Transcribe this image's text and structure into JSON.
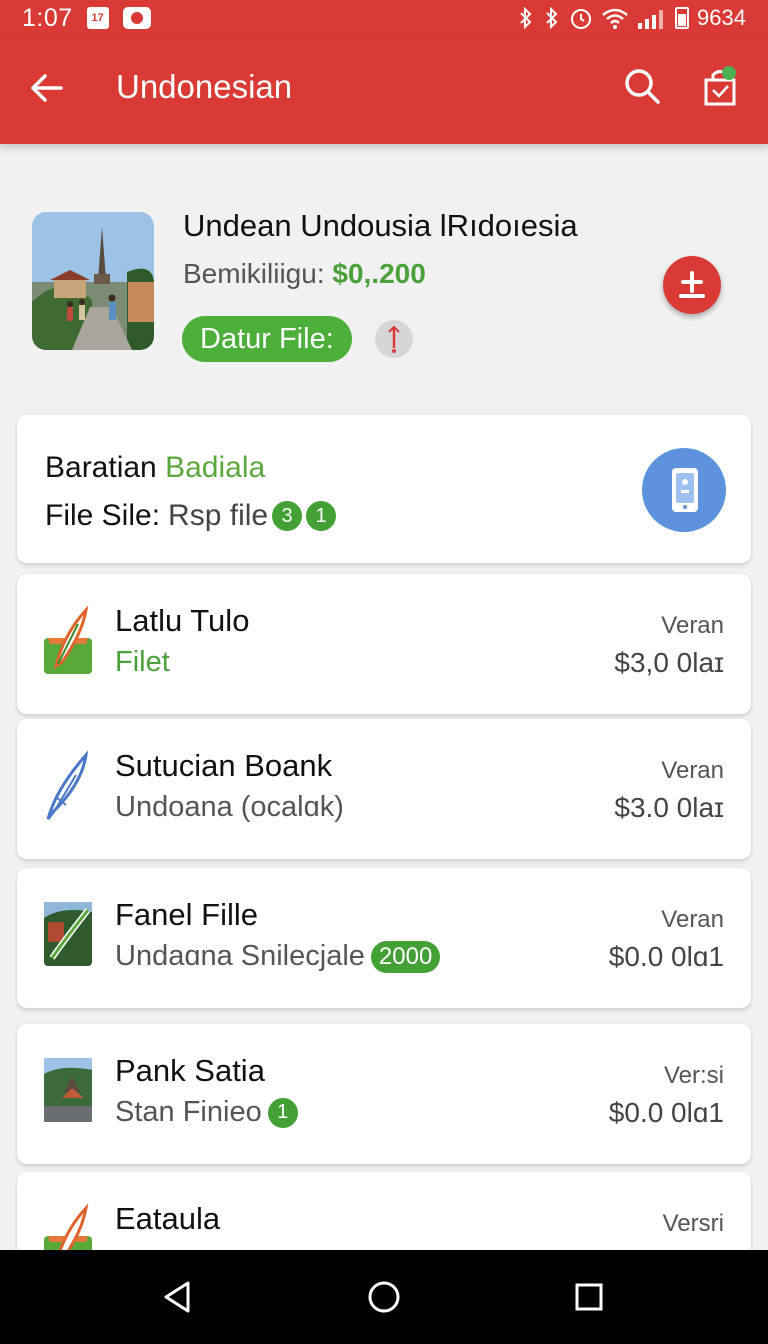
{
  "status_bar": {
    "time": "1:07",
    "calendar_day": "17",
    "battery_text": "9634"
  },
  "app_bar": {
    "title": "Undonesian",
    "back_icon": "arrow-left-icon",
    "search_icon": "search-icon",
    "cart_icon": "cart-icon"
  },
  "hero": {
    "title": "Undean Undousia lRıdoıesia",
    "price_label": "Bemikiliigu:",
    "price_value": "$0,.200",
    "pill_label": "Datur File:",
    "info_icon": "info-exclamation-icon",
    "add_icon": "add-icon"
  },
  "summary": {
    "label": "Baratian",
    "accent": "Badiala",
    "file_label": "File Sile:",
    "file_value": "Rsp file",
    "badges": [
      "3",
      "1"
    ],
    "phone_icon": "smartphone-icon"
  },
  "items": [
    {
      "title": "Latlu Tulo",
      "subtitle": "Filet",
      "badge": "",
      "label": "Veran",
      "price": "$3,0 0laɪ",
      "icon": "feather-quill-icon"
    },
    {
      "title": "Sutucian Boank",
      "subtitle": "Undoana (ocalɑk)",
      "badge": "",
      "label": "Veran",
      "price": "$3.0 0laɪ",
      "icon": "pen-nib-icon"
    },
    {
      "title": "Fanel Fille",
      "subtitle": "Undaɑna Snilecjale",
      "badge": "2000",
      "label": "Veran",
      "price": "$0.0 0lɑ1",
      "icon": "photo-check-icon"
    },
    {
      "title": "Pank  Satia",
      "subtitle": "Stan Finieo",
      "badge": "1",
      "label": "Ver:si",
      "price": "$0.0 0lɑ1",
      "icon": "landscape-photo-icon"
    },
    {
      "title": "Eataula",
      "subtitle": "",
      "badge": "",
      "label": "Versri",
      "price": "",
      "icon": "feather-quill-icon"
    }
  ],
  "nav_bar": {
    "back_icon": "nav-back-icon",
    "home_icon": "nav-home-icon",
    "recents_icon": "nav-recents-icon"
  },
  "colors": {
    "primary": "#d93a35",
    "accent_green": "#4caf3a",
    "phone_blue": "#5c93dc"
  }
}
